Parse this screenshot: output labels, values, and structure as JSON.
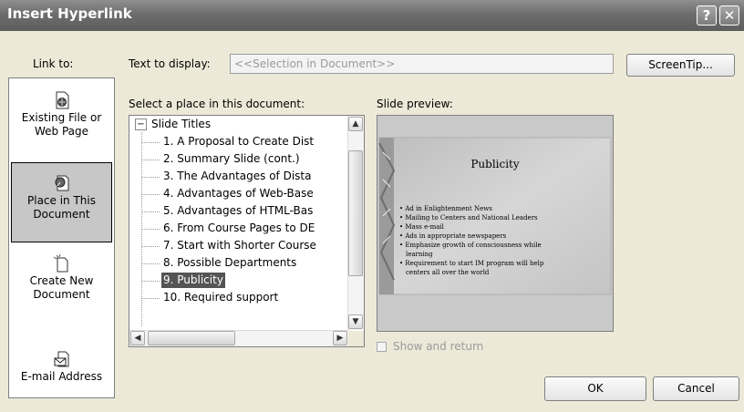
{
  "dialog": {
    "title": "Insert Hyperlink",
    "help_glyph": "?",
    "close_glyph": "✕"
  },
  "link_to": {
    "label": "Link to:",
    "items": [
      {
        "label_lines": [
          "Existing File or",
          "Web Page"
        ]
      },
      {
        "label_lines": [
          "Place in This",
          "Document"
        ]
      },
      {
        "label_lines": [
          "Create New",
          "Document"
        ]
      },
      {
        "label_lines": [
          "E-mail Address"
        ]
      }
    ]
  },
  "text_to_display": {
    "label": "Text to display:",
    "value": "<<Selection in Document>>"
  },
  "screentip_button": "ScreenTip...",
  "place": {
    "label": "Select a place in this document:",
    "root": "Slide Titles",
    "root_toggle": "⊟",
    "items": [
      "1. A Proposal to Create Dist",
      "2. Summary Slide (cont.)",
      "3. The Advantages of  Dista",
      "4. Advantages of Web-Base",
      "5. Advantages of HTML-Bas",
      "6. From Course Pages to DE",
      "7. Start with Shorter Course",
      "8. Possible Departments",
      "9. Publicity",
      "10. Required support"
    ],
    "selected_index": 8,
    "scroll_up": "⌃",
    "scroll_down": "⌄",
    "scroll_left": "‹",
    "scroll_right": "›"
  },
  "preview": {
    "label": "Slide preview:",
    "slide_title": "Publicity",
    "bullets": [
      "Ad in Enlightenment News",
      "Mailing to Centers and National Leaders",
      "Mass e-mail",
      "Ads in appropriate newspapers",
      "Emphasize growth of consciousness while",
      "learning",
      "Requirement to start IM program will help",
      "centers all over the world"
    ],
    "bullet_marks": [
      true,
      true,
      true,
      true,
      true,
      false,
      true,
      false
    ]
  },
  "show_and_return": {
    "label": "Show and return",
    "checked": false
  },
  "ok_button": "OK",
  "cancel_button": "Cancel",
  "colors": {
    "title_bar": "#6d6d6d",
    "dialog_bg": "#ece9d8",
    "selection": "#545454"
  }
}
